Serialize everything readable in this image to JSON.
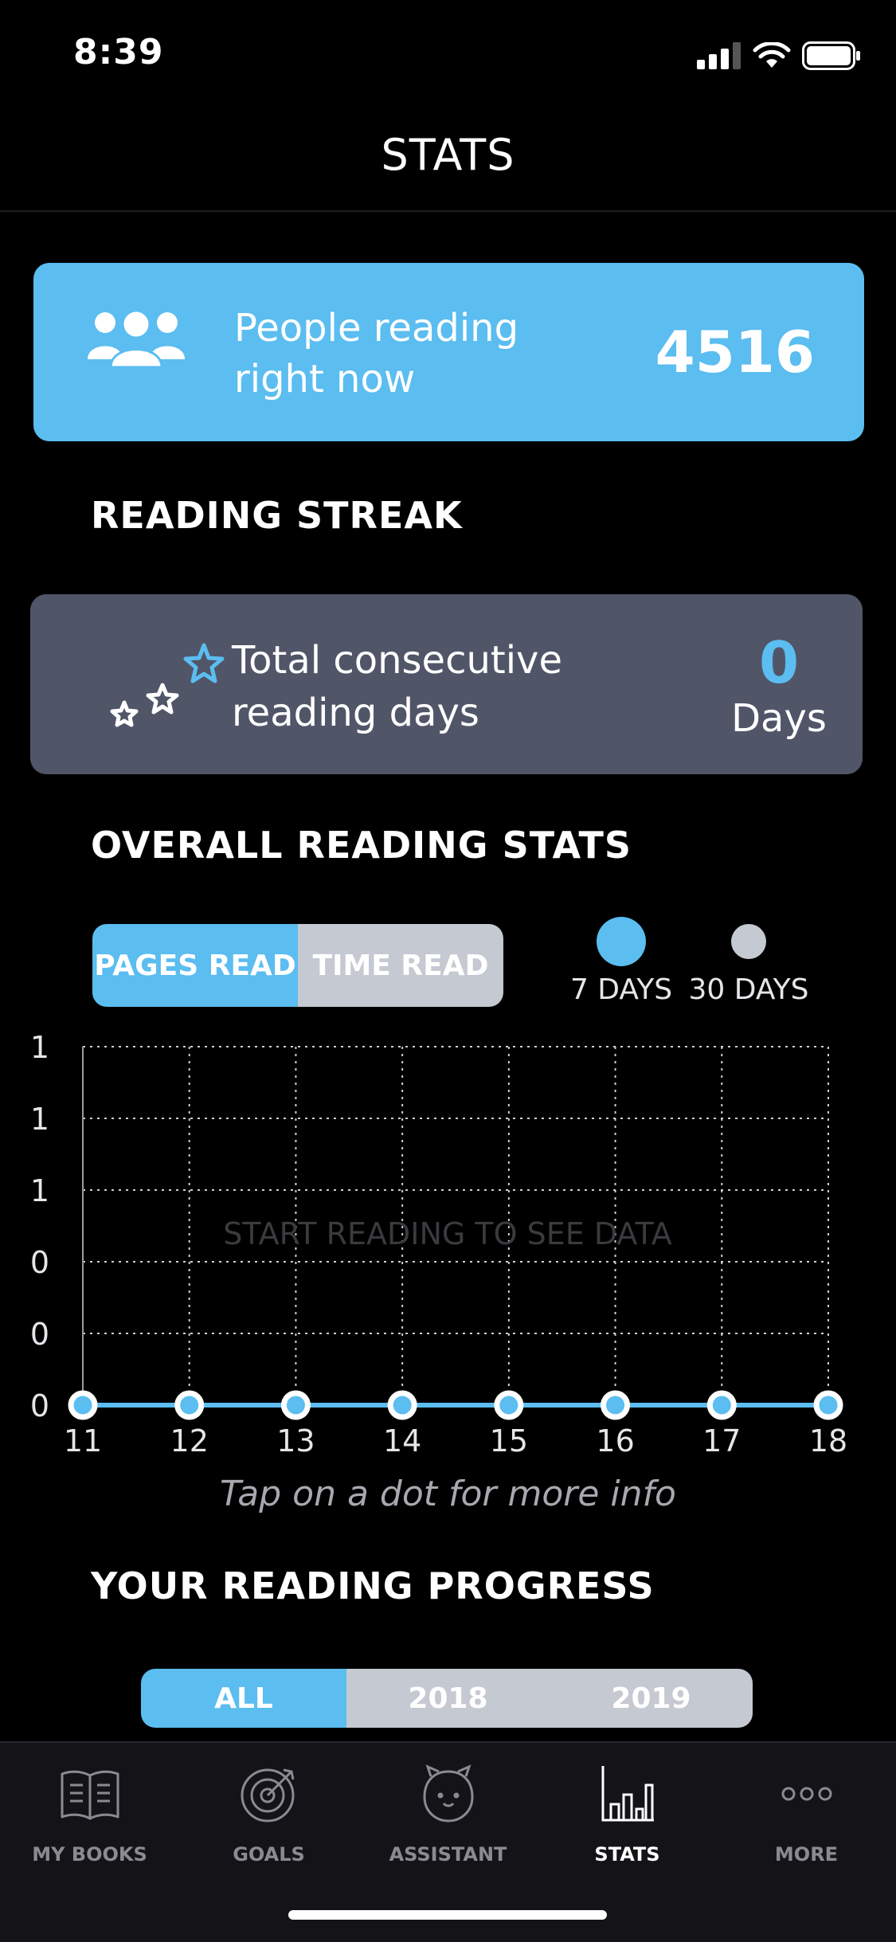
{
  "status_bar": {
    "time": "8:39"
  },
  "header": {
    "title": "STATS"
  },
  "people_card": {
    "label": "People reading right now",
    "count": "4516"
  },
  "streak": {
    "section_title": "READING STREAK",
    "label": "Total consecutive reading days",
    "count": "0",
    "unit": "Days"
  },
  "overall": {
    "section_title": "OVERALL READING STATS",
    "metric_tabs": [
      {
        "label": "PAGES READ",
        "selected": true
      },
      {
        "label": "TIME READ",
        "selected": false
      }
    ],
    "range_options": [
      {
        "label": "7 DAYS",
        "selected": true
      },
      {
        "label": "30 DAYS",
        "selected": false
      }
    ],
    "hint": "Tap on a dot for more info"
  },
  "chart_data": {
    "type": "line",
    "x": [
      11,
      12,
      13,
      14,
      15,
      16,
      17,
      18
    ],
    "values": [
      0,
      0,
      0,
      0,
      0,
      0,
      0,
      0
    ],
    "y_tick_labels": [
      "0",
      "0",
      "0",
      "1",
      "1",
      "1"
    ],
    "empty_message": "START READING TO SEE DATA",
    "grid": true,
    "colors": {
      "line": "#5bbdf0",
      "point_fill": "#5bbdf0",
      "point_ring": "#ffffff",
      "grid": "#cfcfd6"
    }
  },
  "progress": {
    "section_title": "YOUR READING PROGRESS",
    "tabs": [
      {
        "label": "ALL",
        "selected": true
      },
      {
        "label": "2018",
        "selected": false
      },
      {
        "label": "2019",
        "selected": false
      }
    ]
  },
  "tab_bar": {
    "items": [
      {
        "label": "MY BOOKS",
        "icon": "book-icon",
        "active": false
      },
      {
        "label": "GOALS",
        "icon": "target-icon",
        "active": false
      },
      {
        "label": "ASSISTANT",
        "icon": "assistant-face-icon",
        "active": false
      },
      {
        "label": "STATS",
        "icon": "bar-chart-icon",
        "active": true
      },
      {
        "label": "MORE",
        "icon": "more-dots-icon",
        "active": false
      }
    ]
  },
  "colors": {
    "accent": "#5bbdf0",
    "card_gray": "#515568",
    "background": "#000000",
    "toggle_off": "#c4c9d2"
  }
}
